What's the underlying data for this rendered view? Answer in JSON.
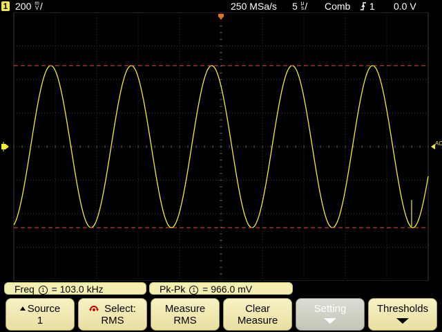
{
  "status": {
    "channel": "1",
    "volts_value": "200",
    "volts_num": "m",
    "volts_den": "V",
    "sample_rate": "250 MSa/s",
    "time_value": "5",
    "time_num": "µ",
    "time_den": "s",
    "acq_mode": "Comb",
    "trigger_source": "1",
    "trigger_level": "0.0 V"
  },
  "markers": {
    "right_trigger_label": "AC"
  },
  "colors": {
    "trace": "#f2ef3a",
    "cursor": "#e05050",
    "grid": "#3a3a3a",
    "softkey": "#f4eeb0"
  },
  "waveform": {
    "frequency_khz": 103.0,
    "peak_to_peak_mv": 966.0,
    "time_per_div_us": 5,
    "volts_per_div_mv": 200
  },
  "measurements": [
    {
      "label": "Freq",
      "channel": "1",
      "value": "= 103.0 kHz"
    },
    {
      "label": "Pk-Pk",
      "channel": "1",
      "value": "= 966.0 mV"
    }
  ],
  "softkeys": [
    {
      "line1": "Source",
      "line2": "1"
    },
    {
      "line1": "Select:",
      "line2": "RMS"
    },
    {
      "line1": "Measure",
      "line2": "RMS"
    },
    {
      "line1": "Clear",
      "line2": "Measure"
    },
    {
      "line1": "Setting",
      "line2": ""
    },
    {
      "line1": "Thresholds",
      "line2": ""
    }
  ]
}
